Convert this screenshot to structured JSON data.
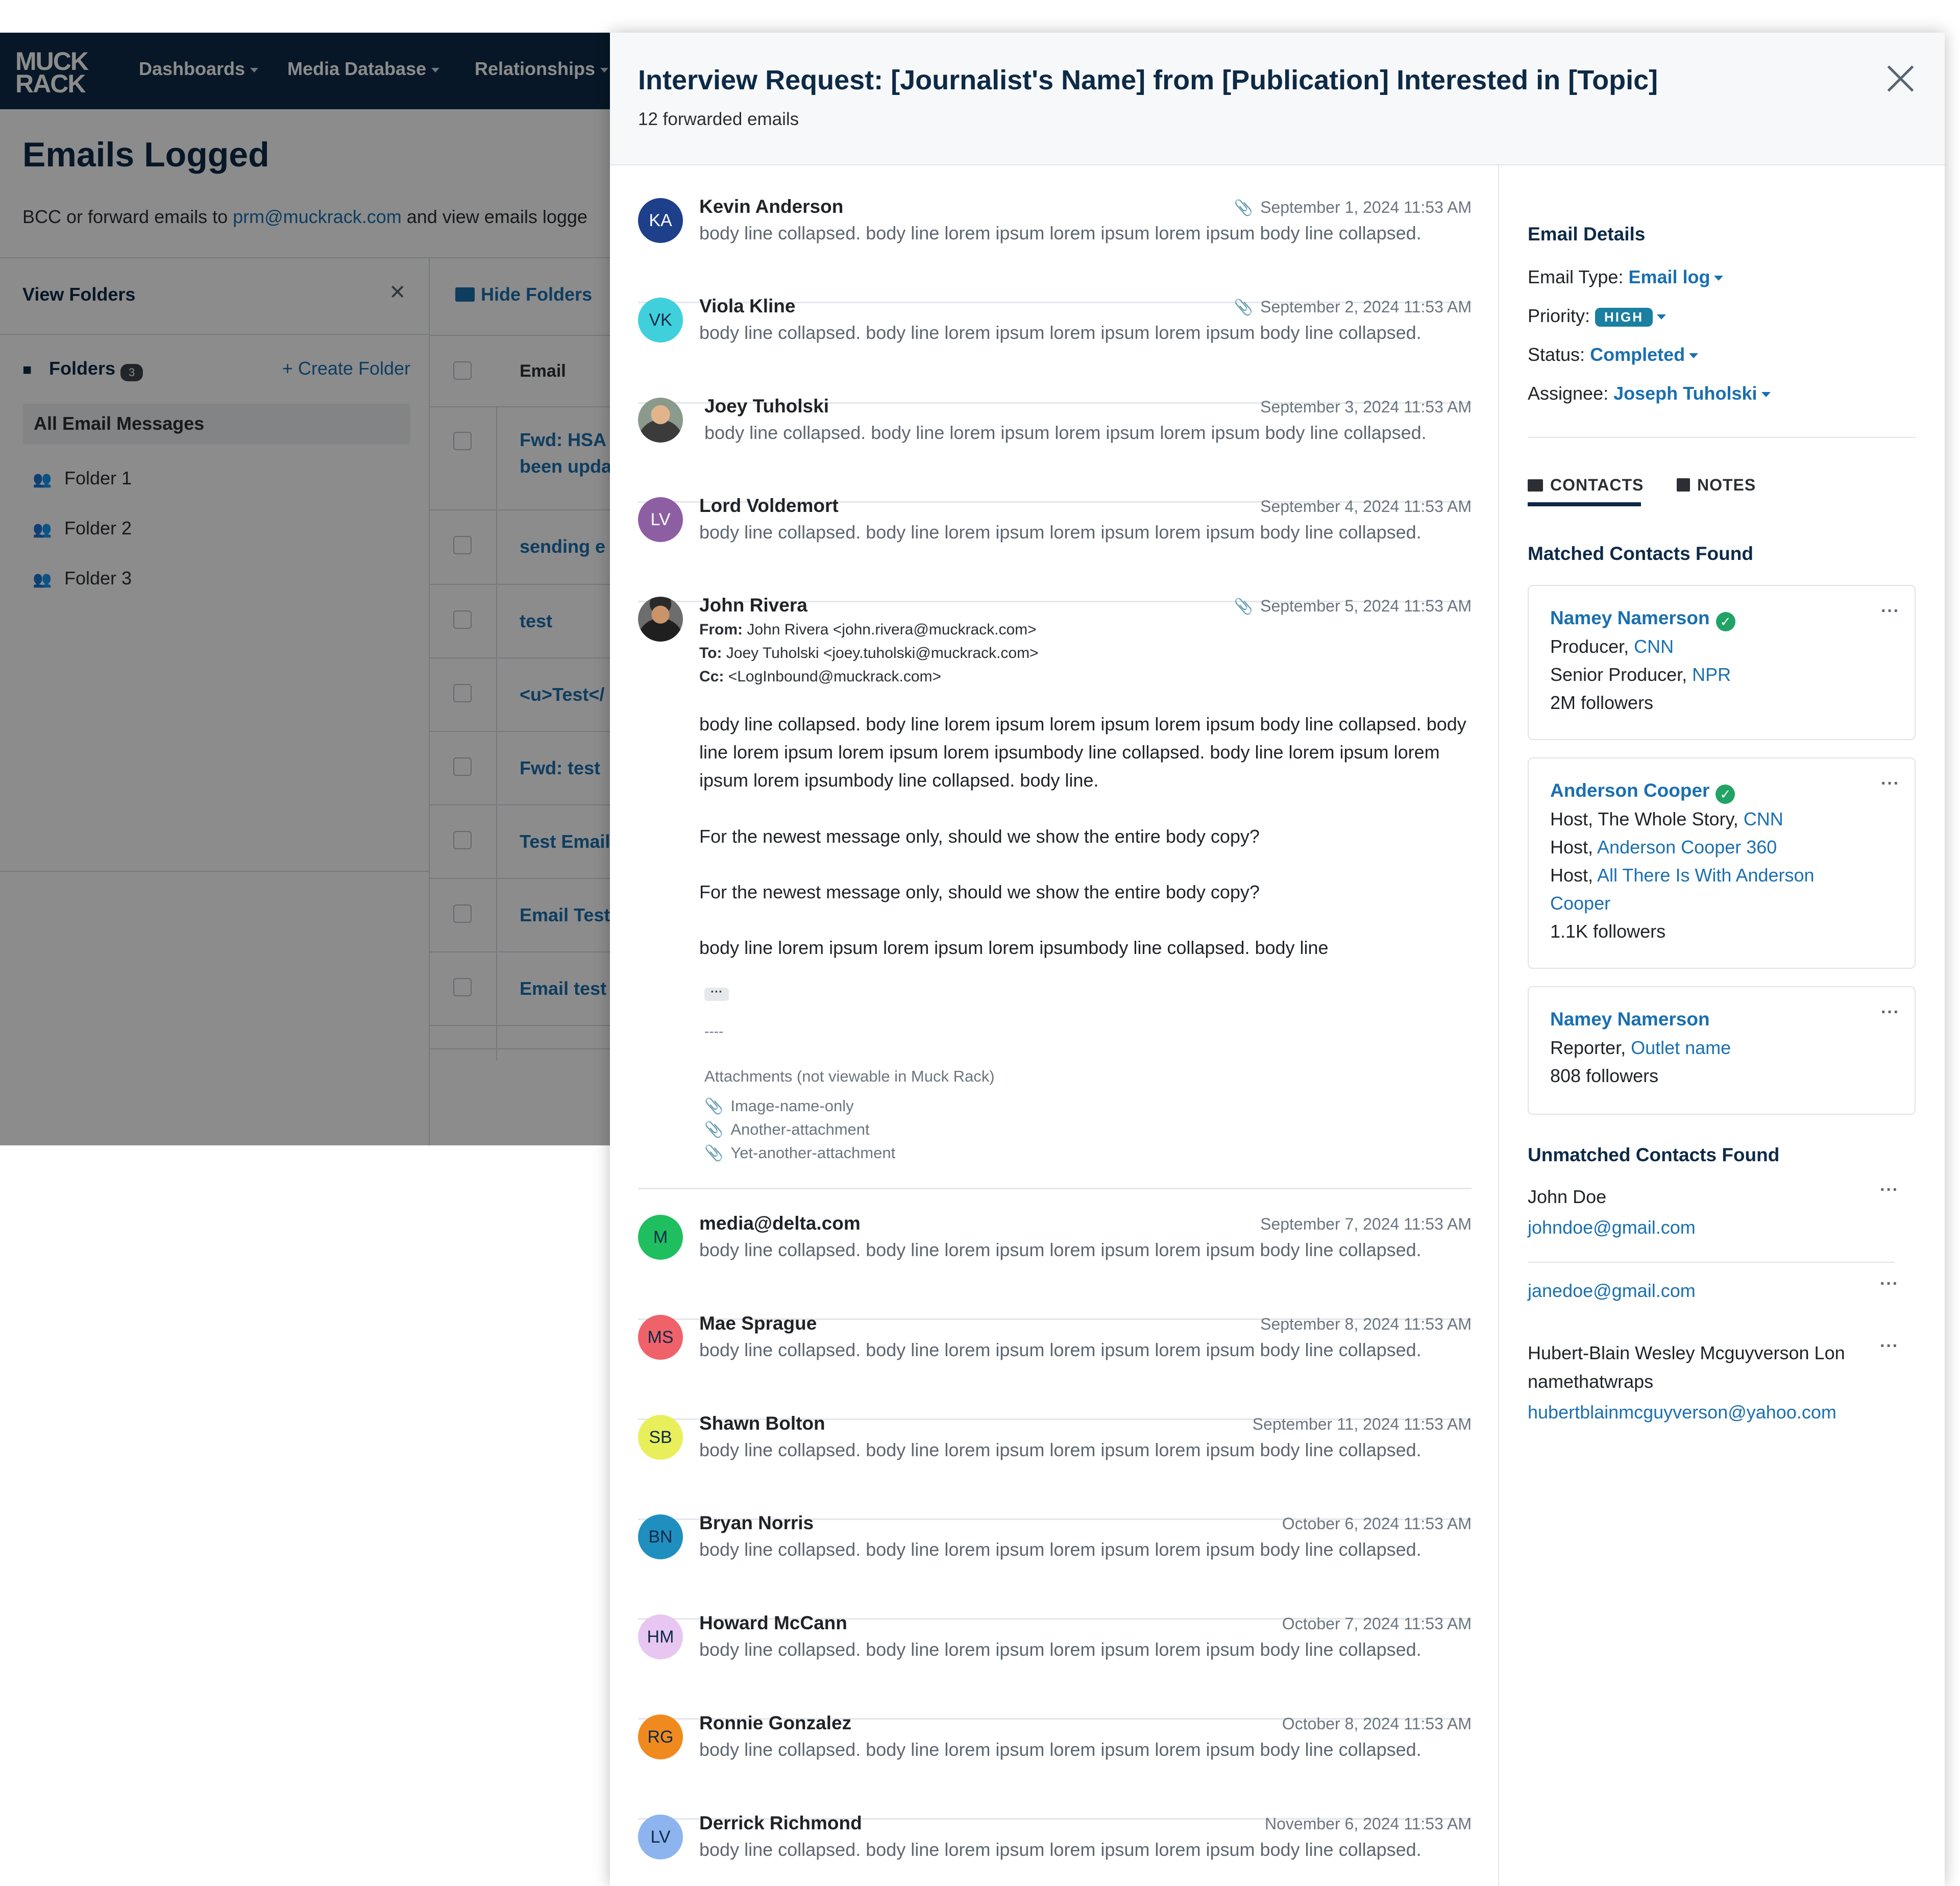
{
  "app": {
    "logo": "MUCK RACK",
    "nav": [
      "Dashboards",
      "Media Database",
      "Relationships"
    ],
    "page_title": "Emails Logged",
    "subtitle_prefix": "BCC or forward emails to ",
    "subtitle_link": "prm@muckrack.com",
    "subtitle_suffix": " and view emails logge",
    "view_folders": "View Folders",
    "folders_label": "Folders",
    "folders_count": "3",
    "create_folder": "Create Folder",
    "all_email": "All Email Messages",
    "folders": [
      "Folder 1",
      "Folder 2",
      "Folder 3"
    ],
    "hide_folders": "Hide Folders",
    "email_col": "Email",
    "subjects": [
      "Fwd: HSA",
      "been upda",
      "sending e",
      "test",
      "<u>Test</",
      "Fwd: test",
      "Test Email",
      "Email Test",
      "Email test"
    ]
  },
  "modal": {
    "title": "Interview Request: [Journalist's Name] from [Publication] Interested in [Topic]",
    "count": "12 forwarded emails",
    "close_glyph": "×",
    "emails": [
      {
        "initials": "KA",
        "name": "Kevin Anderson",
        "date": "September 1, 2024 11:53 AM",
        "preview": "body line collapsed. body line lorem ipsum lorem ipsum lorem ipsum body line collapsed.",
        "color": "#1e3f8a",
        "text_color": "#ffffff"
      },
      {
        "initials": "VK",
        "name": "Viola Kline",
        "date": "September 2, 2024 11:53 AM",
        "preview": "body line collapsed. body line lorem ipsum lorem ipsum lorem ipsum body line collapsed.",
        "color": "#3fd0dc",
        "text_color": "#0d2a47"
      },
      {
        "initials": "",
        "name": "Joey Tuholski",
        "date": "September 3, 2024 11:53 AM",
        "preview": "body line collapsed. body line lorem ipsum lorem ipsum lorem ipsum body line collapsed.",
        "color": "#8a9a8c",
        "text_color": "#ffffff"
      },
      {
        "initials": "LV",
        "name": "Lord Voldemort",
        "date": "September 4, 2024 11:53 AM",
        "preview": "body line collapsed. body line lorem ipsum lorem ipsum lorem ipsum body line collapsed.",
        "color": "#8e5ea2",
        "text_color": "#ffffff"
      },
      {
        "initials": "",
        "name": "John Rivera",
        "date": "September 5, 2024 11:53 AM",
        "from_label": "From:",
        "from": "John Rivera <john.rivera@muckrack.com>",
        "to_label": "To:",
        "to": "Joey Tuholski <joey.tuholski@muckrack.com>",
        "cc_label": "Cc:",
        "cc": "<LogInbound@muckrack.com>",
        "body1": "body line collapsed. body line lorem ipsum lorem ipsum lorem ipsum body line collapsed. body line lorem ipsum lorem ipsum lorem ipsumbody line collapsed. body line lorem ipsum lorem ipsum lorem ipsumbody line collapsed. body line.",
        "body2": "For the newest message only, should we show the entire body copy?",
        "body3": "For the newest message only, should we show the entire body copy?",
        "body4": "body line lorem ipsum lorem ipsum lorem ipsumbody line collapsed. body line",
        "more": "···",
        "dash": "----",
        "attachments_label": "Attachments (not viewable in Muck Rack)",
        "attachments": [
          "Image-name-only",
          "Another-attachment",
          "Yet-another-attachment"
        ]
      },
      {
        "initials": "M",
        "name": "media@delta.com",
        "date": "September 7, 2024 11:53 AM",
        "preview": "body line collapsed. body line lorem ipsum lorem ipsum lorem ipsum body line collapsed.",
        "color": "#1fbf5f",
        "text_color": "#0d2a47"
      },
      {
        "initials": "MS",
        "name": "Mae Sprague",
        "date": "September 8, 2024 11:53 AM",
        "preview": "body line collapsed. body line lorem ipsum lorem ipsum lorem ipsum body line collapsed.",
        "color": "#f0626a",
        "text_color": "#0d2a47"
      },
      {
        "initials": "SB",
        "name": "Shawn Bolton",
        "date": "September 11, 2024 11:53 AM",
        "preview": "body line collapsed. body line lorem ipsum lorem ipsum lorem ipsum body line collapsed.",
        "color": "#e9ef5a",
        "text_color": "#0d2a47"
      },
      {
        "initials": "BN",
        "name": "Bryan Norris",
        "date": "October 6, 2024 11:53 AM",
        "preview": "body line collapsed. body line lorem ipsum lorem ipsum lorem ipsum body line collapsed.",
        "color": "#1f8fc0",
        "text_color": "#0d2a47"
      },
      {
        "initials": "HM",
        "name": "Howard McCann",
        "date": "October 7, 2024 11:53 AM",
        "preview": "body line collapsed. body line lorem ipsum lorem ipsum lorem ipsum body line collapsed.",
        "color": "#e8c6f2",
        "text_color": "#0d2a47"
      },
      {
        "initials": "RG",
        "name": "Ronnie Gonzalez",
        "date": "October 8, 2024 11:53 AM",
        "preview": "body line collapsed. body line lorem ipsum lorem ipsum lorem ipsum body line collapsed.",
        "color": "#f08a1f",
        "text_color": "#0d2a47"
      },
      {
        "initials": "LV",
        "name": "Derrick Richmond",
        "date": "November 6, 2024 11:53 AM",
        "preview": "body line collapsed. body line lorem ipsum lorem ipsum lorem ipsum body line collapsed.",
        "color": "#8db4ee",
        "text_color": "#0d2a47"
      }
    ]
  },
  "details": {
    "heading": "Email Details",
    "type_label": "Email Type:",
    "type_value": "Email log",
    "priority_label": "Priority:",
    "priority_value": "HIGH",
    "status_label": "Status:",
    "status_value": "Completed",
    "assignee_label": "Assignee:",
    "assignee_value": "Joseph Tuholski",
    "tab_contacts": "CONTACTS",
    "tab_notes": "NOTES",
    "matched_heading": "Matched Contacts Found",
    "matched": [
      {
        "name": "Namey Namerson",
        "verified": true,
        "lines": [
          [
            "Producer, ",
            "CNN"
          ],
          [
            "Senior Producer, ",
            "NPR"
          ],
          [
            "2M followers",
            ""
          ]
        ]
      },
      {
        "name": "Anderson Cooper",
        "verified": true,
        "lines": [
          [
            "Host, The Whole Story, ",
            "CNN"
          ],
          [
            "Host, ",
            "Anderson Cooper 360"
          ],
          [
            "Host, ",
            "All There Is With Anderson"
          ],
          [
            "",
            "Cooper"
          ],
          [
            "1.1K followers",
            ""
          ]
        ]
      },
      {
        "name": "Namey Namerson",
        "verified": false,
        "lines": [
          [
            "Reporter, ",
            "Outlet name"
          ],
          [
            "808 followers",
            ""
          ]
        ]
      }
    ],
    "unmatched_heading": "Unmatched Contacts Found",
    "unmatched": [
      {
        "name": "John Doe",
        "email": "johndoe@gmail.com"
      },
      {
        "name": "",
        "email": "janedoe@gmail.com"
      },
      {
        "name": "Hubert-Blain Wesley Mcguyverson Lon namethatwraps",
        "name_line1": "Hubert-Blain Wesley Mcguyverson Lon",
        "name_line2": "namethatwraps",
        "email": "hubertblainmcguyverson@yahoo.com"
      }
    ],
    "more_glyph": "···",
    "check_glyph": "✓"
  },
  "colors": {
    "navy": "#0d2a47",
    "link": "#1a6fb0",
    "pill": "#1a7fa0",
    "verified": "#21a366"
  }
}
